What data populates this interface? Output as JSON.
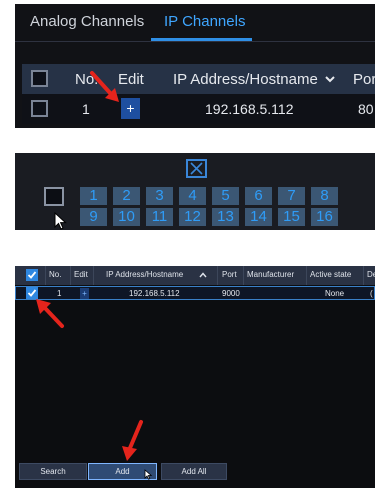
{
  "panel1": {
    "tabs": [
      "Analog Channels",
      "IP Channels"
    ],
    "active_tab": "IP Channels",
    "headers": {
      "no": "No.",
      "edit": "Edit",
      "address": "IP Address/Hostname",
      "sort_icon": "chevron-down-icon",
      "port": "Port"
    },
    "row": {
      "no": "1",
      "edit": "+",
      "address": "192.168.5.112",
      "port": "80"
    }
  },
  "panel2": {
    "channels": [
      "1",
      "2",
      "3",
      "4",
      "5",
      "6",
      "7",
      "8",
      "9",
      "10",
      "11",
      "12",
      "13",
      "14",
      "15",
      "16"
    ]
  },
  "panel3": {
    "headers": {
      "no": "No.",
      "edit": "Edit",
      "address": "IP Address/Hostname",
      "port": "Port",
      "manufacturer": "Manufacturer",
      "active_state": "Active state",
      "de": "De"
    },
    "row": {
      "no": "1",
      "edit": "+",
      "address": "192.168.5.112",
      "port": "9000",
      "manufacturer": "",
      "active_state": "None",
      "de": "("
    },
    "buttons": {
      "search": "Search",
      "add": "Add",
      "add_all": "Add All"
    }
  },
  "colors": {
    "accent": "#2f8fe6",
    "annotation_arrow": "#e5241c",
    "panel_bg": "#111216",
    "header_bg": "#263246"
  }
}
